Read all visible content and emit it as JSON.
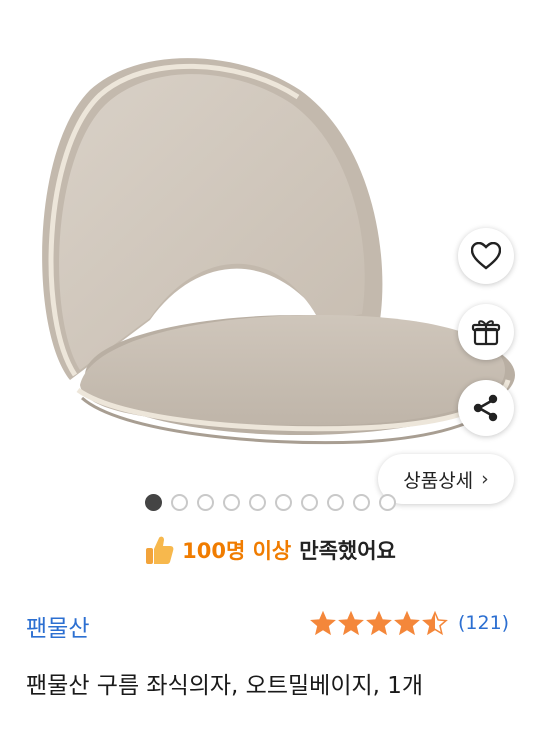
{
  "product_image": {
    "alt": ""
  },
  "actions": {
    "like_icon": "heart-icon",
    "gift_icon": "gift-icon",
    "share_icon": "share-icon"
  },
  "detail_button": {
    "label": "상품상세",
    "chevron": "›"
  },
  "carousel": {
    "total": 10,
    "current": 1
  },
  "satisfaction": {
    "highlight": "100명 이상",
    "rest": "만족했어요"
  },
  "brand": "팬물산",
  "rating": {
    "value": 4.5,
    "max": 5,
    "count": "(121)"
  },
  "title": "팬물산 구름 좌식의자, 오트밀베이지, 1개",
  "colors": {
    "accent_blue": "#2c6fd1",
    "star": "#f4873a",
    "highlight": "#f07c00"
  }
}
